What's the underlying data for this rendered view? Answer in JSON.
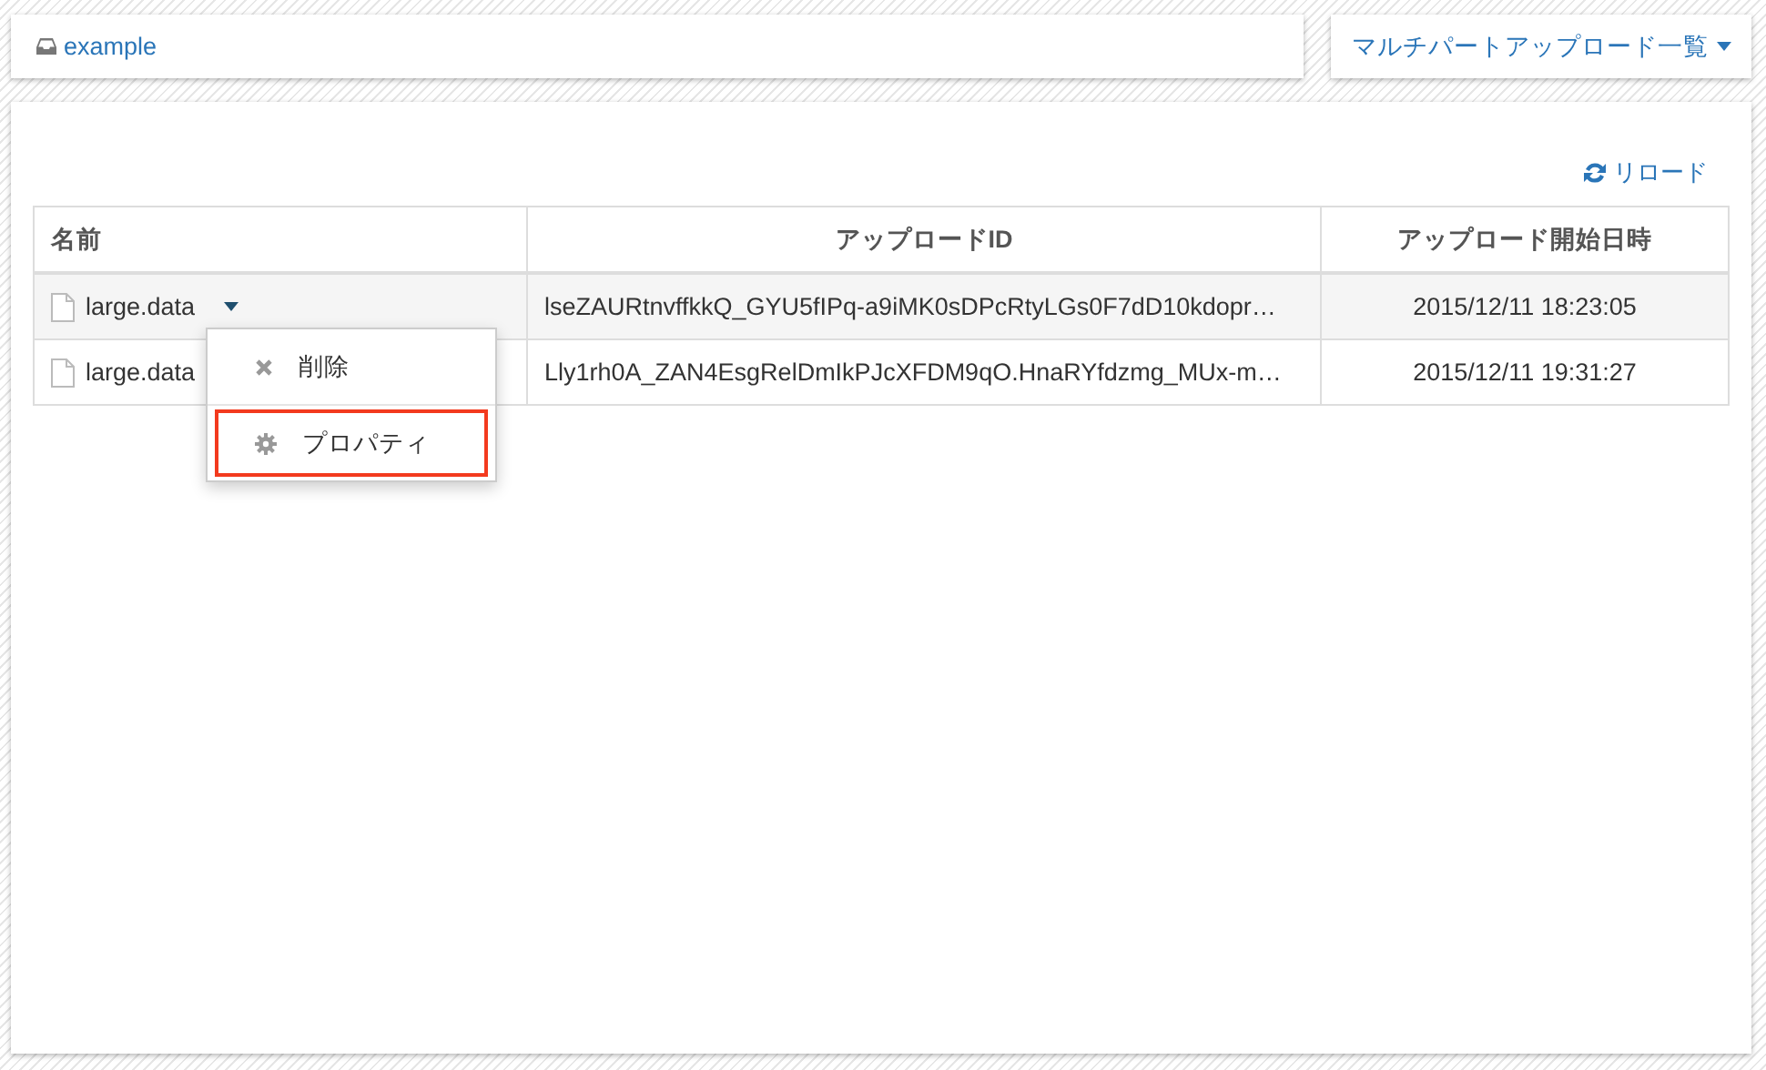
{
  "breadcrumb": {
    "label": "example"
  },
  "upload_list_button": {
    "label": "マルチパートアップロード一覧"
  },
  "reload_button": {
    "label": "リロード"
  },
  "table": {
    "columns": [
      "名前",
      "アップロードID",
      "アップロード開始日時"
    ],
    "rows": [
      {
        "name": "large.data",
        "upload_id": "lseZAURtnvffkkQ_GYU5fIPq-a9iMK0sDPcRtyLGs0F7dD10kdopr…",
        "started": "2015/12/11 18:23:05",
        "expanded": true
      },
      {
        "name": "large.data",
        "upload_id": "Lly1rh0A_ZAN4EsgRelDmIkPJcXFDM9qO.HnaRYfdzmg_MUx-m…",
        "started": "2015/12/11 19:31:27",
        "expanded": false
      }
    ]
  },
  "context_menu": {
    "items": [
      {
        "kind": "delete",
        "label": "削除",
        "highlighted": false
      },
      {
        "kind": "properties",
        "label": "プロパティ",
        "highlighted": true
      }
    ]
  }
}
